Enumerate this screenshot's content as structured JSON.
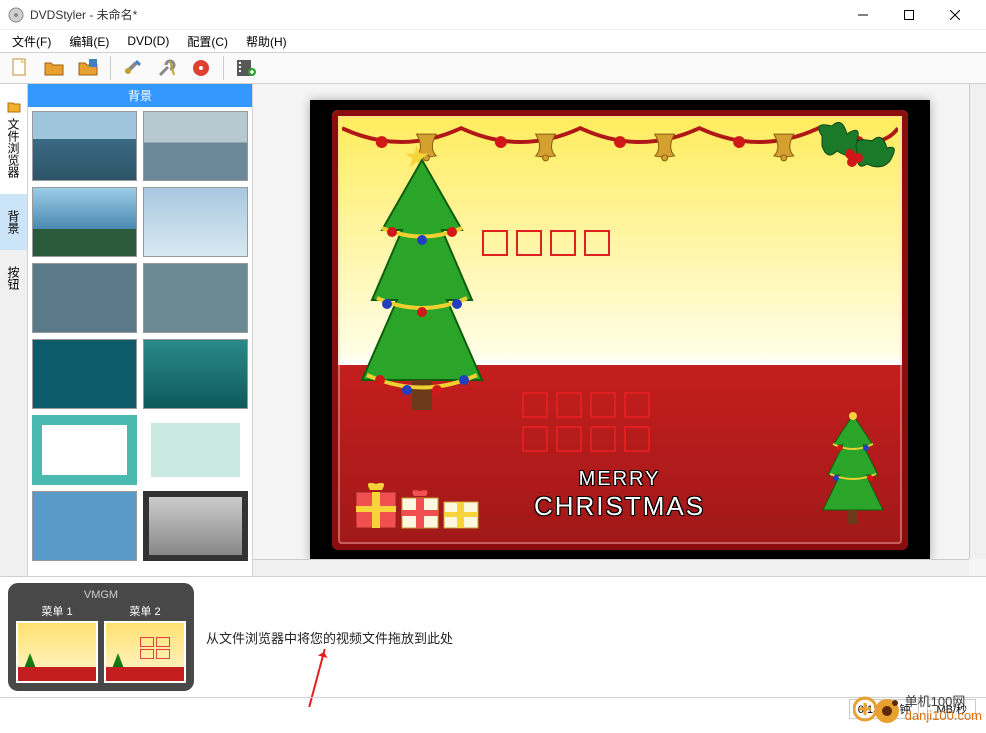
{
  "window": {
    "title": "DVDStyler - 未命名*"
  },
  "menubar": {
    "items": [
      {
        "label": "文件(F)"
      },
      {
        "label": "编辑(E)"
      },
      {
        "label": "DVD(D)"
      },
      {
        "label": "配置(C)"
      },
      {
        "label": "帮助(H)"
      }
    ]
  },
  "sideTabs": {
    "file": "文件浏览器",
    "background": "背景",
    "buttons": "按钮"
  },
  "thumbHeader": "背景",
  "timeline": {
    "vmgm_label": "VMGM",
    "menu1_label": "菜单 1",
    "menu2_label": "菜单 2",
    "drop_hint": "从文件浏览器中将您的视频文件拖放到此处"
  },
  "status": {
    "duration": "0/136 分钟",
    "speed": "MB/秒"
  },
  "preview": {
    "merry_line1": "MERRY",
    "merry_line2": "CHRISTMAS"
  },
  "watermark": {
    "line1": "单机100网",
    "line2": "danji100.com"
  }
}
